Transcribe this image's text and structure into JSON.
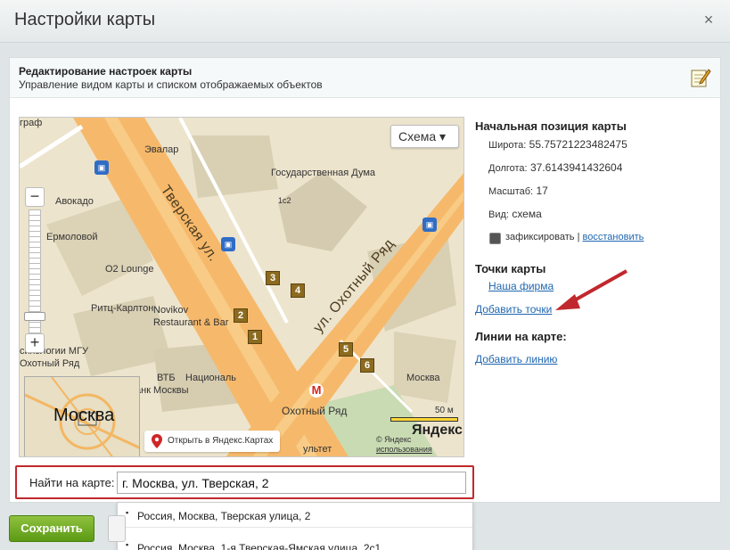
{
  "dialog": {
    "title": "Настройки карты",
    "close_icon": "×"
  },
  "panel": {
    "title": "Редактирование настроек карты",
    "subtitle": "Управление видом карты и списком отображаемых объектов"
  },
  "map": {
    "scheme_button": "Схема ▾",
    "streets": [
      "Тверская ул.",
      "ул. Охотный Ряд"
    ],
    "labels": [
      "Эвалар",
      "Государственная Дума",
      "Авокадо",
      "Ермоловой",
      "O2 Lounge",
      "Ритц-Карлтон",
      "Novikov",
      "Restaurant & Bar",
      "ВТБ",
      "анк Москвы",
      "Националь",
      "Охотный Ряд",
      "Москва",
      "ультет",
      "сихологии МГУ",
      "Охотный Ряд",
      "1с2",
      "граф"
    ],
    "points": [
      "1",
      "2",
      "3",
      "4",
      "5",
      "6"
    ],
    "metro_icon": "М",
    "bus_icon": "🚌",
    "minimap_label": "Москва",
    "open_yandex": "Открыть в Яндекс.Картах",
    "copyright": "© Яндекс",
    "terms": "использования",
    "scale": "50 м",
    "logo": "Яндекс",
    "zoom_plus": "+",
    "zoom_minus": "−"
  },
  "search": {
    "label": "Найти на карте:",
    "value": "г. Москва, ул. Тверская, 2",
    "suggestions": [
      "Россия, Москва, Тверская улица, 2",
      "Россия, Москва, 1-я Тверская-Ямская улица, 2с1"
    ]
  },
  "side": {
    "start_heading": "Начальная позиция карты",
    "lat_label": "Широта:",
    "lat_value": "55.75721223482475",
    "lon_label": "Долгота:",
    "lon_value": "37.6143941432604",
    "zoom_label": "Масштаб:",
    "zoom_value": "17",
    "view_label": "Вид:",
    "view_value": "схема",
    "fix_label": "зафиксировать",
    "separator": "|",
    "restore_link": "восстановить",
    "points_heading": "Точки карты",
    "point_item": "Наша фирма",
    "add_points": "Добавить точки",
    "lines_heading": "Линии на карте:",
    "add_line": "Добавить линию"
  },
  "footer": {
    "save": "Сохранить"
  },
  "colors": {
    "accent_red": "#c1282d",
    "save_green": "#6aaa1f",
    "link_blue": "#2067b0"
  }
}
